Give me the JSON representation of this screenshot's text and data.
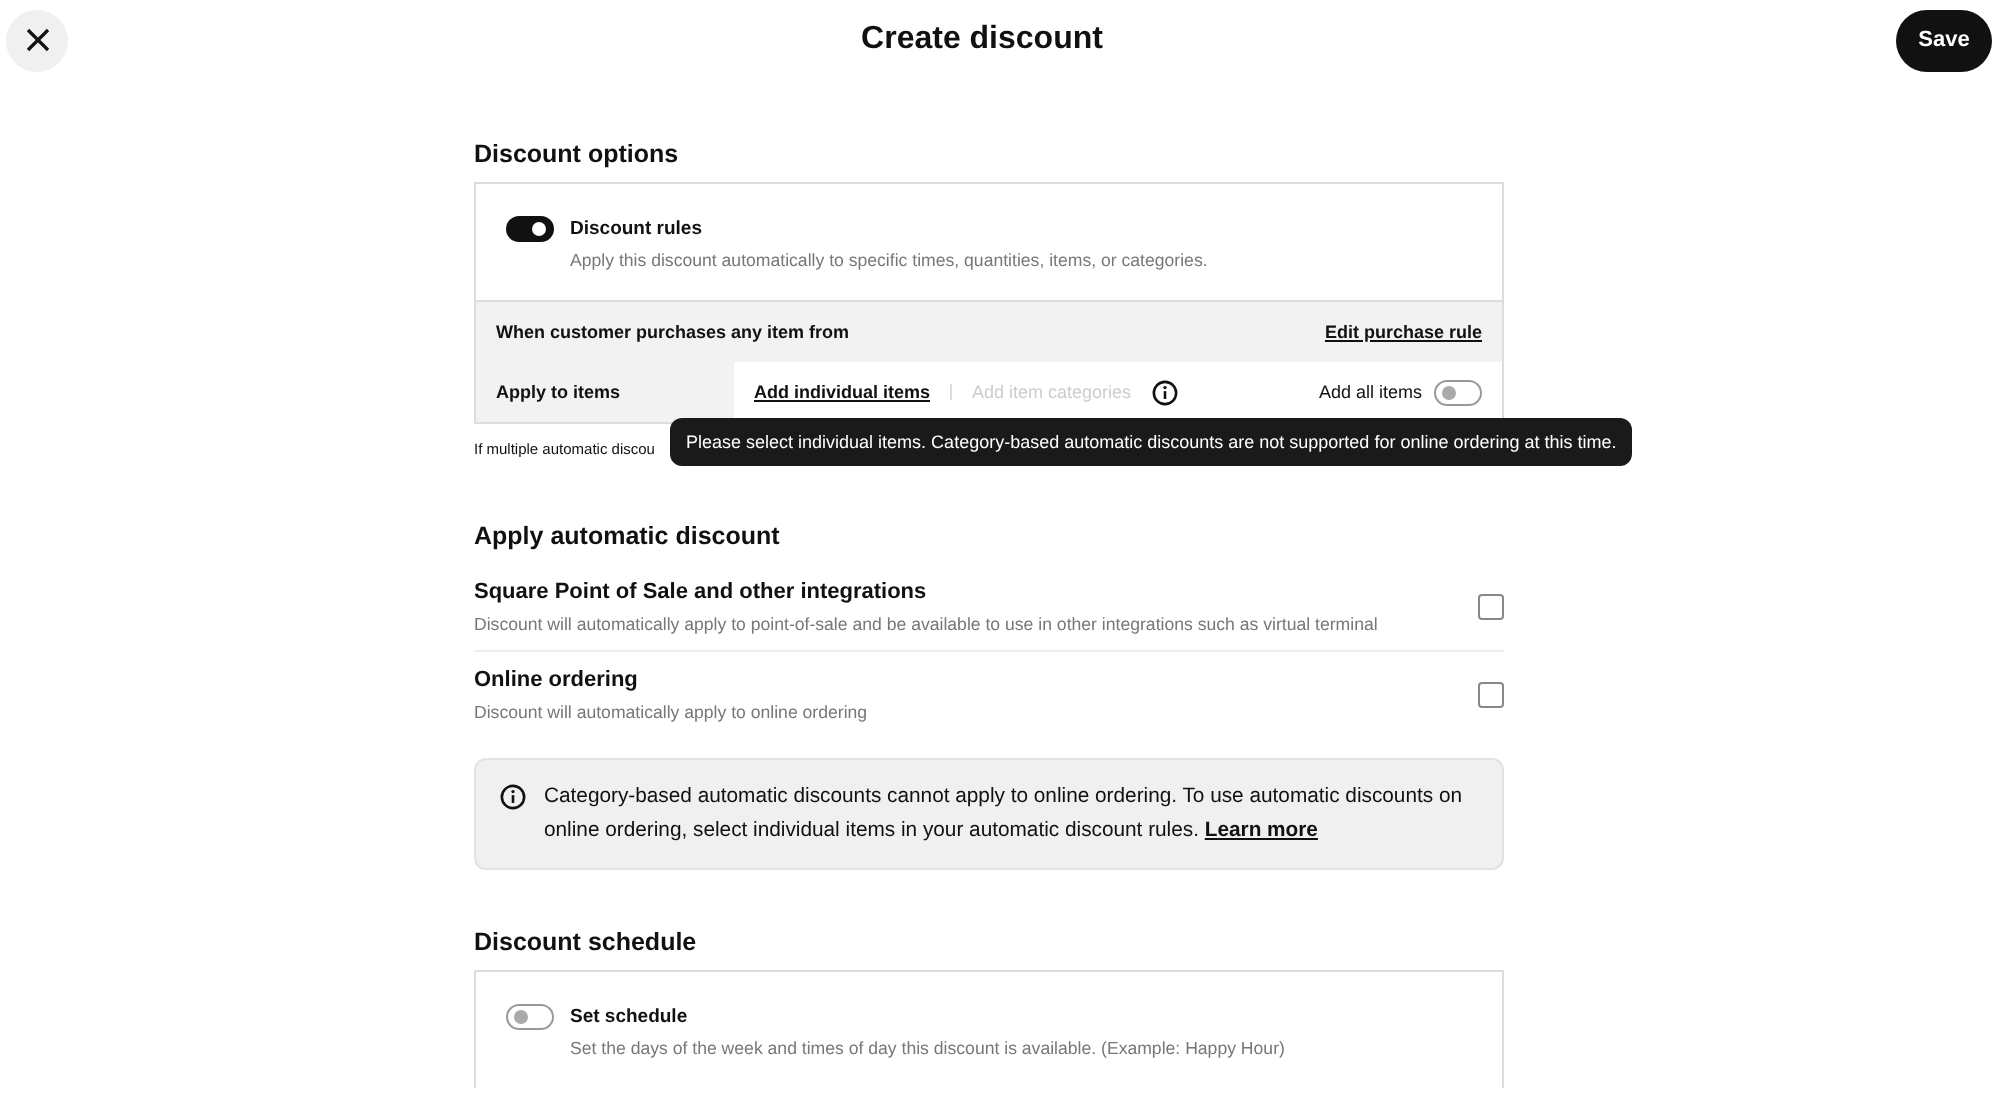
{
  "header": {
    "title": "Create discount",
    "save_label": "Save"
  },
  "discount_options": {
    "heading": "Discount options",
    "rules": {
      "label": "Discount rules",
      "description": "Apply this discount automatically to specific times, quantities, items, or categories.",
      "on": true
    },
    "purchase_rule": {
      "text": "When customer purchases any item from",
      "link": "Edit purchase rule"
    },
    "apply_to": {
      "label": "Apply to items",
      "individual": {
        "label": "Add individual items",
        "disabled": false
      },
      "categories": {
        "label": "Add item categories",
        "disabled": true
      },
      "all_label": "Add all items",
      "all_on": false
    },
    "note": "If multiple automatic discou",
    "tooltip": "Please select individual items. Category-based automatic discounts are not supported for online ordering at this time."
  },
  "apply_automatic": {
    "heading": "Apply automatic discount",
    "options": [
      {
        "title": "Square Point of Sale and other integrations",
        "description": "Discount will automatically apply to point-of-sale and be available to use in other integrations such as virtual terminal",
        "checked": false
      },
      {
        "title": "Online ordering",
        "description": "Discount will automatically apply to online ordering",
        "checked": false
      }
    ],
    "info": {
      "text": "Category-based automatic discounts cannot apply to online ordering. To use automatic discounts on online ordering, select individual items in your automatic discount rules.",
      "link": "Learn more"
    }
  },
  "schedule": {
    "heading": "Discount schedule",
    "label": "Set schedule",
    "description": "Set the days of the week and times of day this discount is available. (Example: Happy Hour)",
    "on": false
  }
}
